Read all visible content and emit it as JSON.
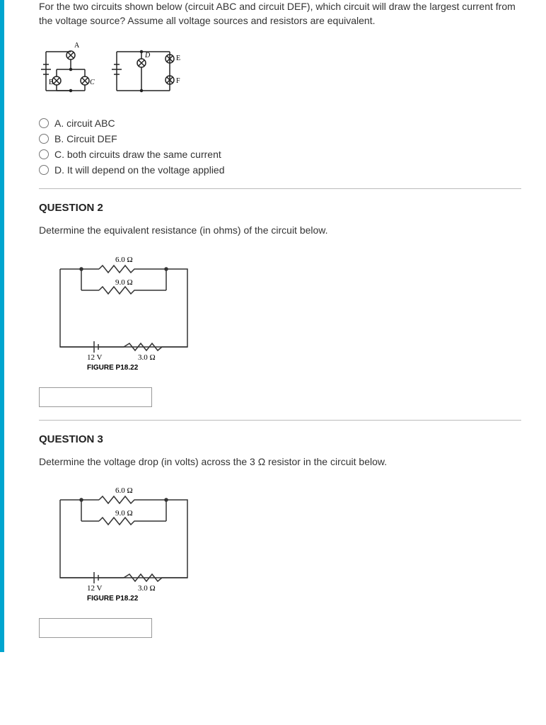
{
  "q1": {
    "prompt": "For the two circuits shown below (circuit ABC and circuit DEF), which circuit will draw the largest current from the voltage source? Assume all voltage sources and resistors are equivalent.",
    "labels": {
      "A": "A",
      "B": "B",
      "C": "C",
      "D": "D",
      "E": "E",
      "F": "F"
    },
    "options": {
      "a": "A. circuit ABC",
      "b": "B. Circuit DEF",
      "c": "C. both circuits draw the same current",
      "d": "D. It will depend on the voltage applied"
    }
  },
  "q2": {
    "heading": "QUESTION 2",
    "prompt": "Determine the equivalent resistance (in ohms) of the circuit below.",
    "fig": {
      "r1": "6.0 Ω",
      "r2": "9.0 Ω",
      "r3": "3.0 Ω",
      "v": "12 V",
      "caption": "FIGURE P18.22"
    },
    "answer": ""
  },
  "q3": {
    "heading": "QUESTION 3",
    "prompt": "Determine the voltage drop (in volts) across the 3 Ω resistor in the circuit below.",
    "fig": {
      "r1": "6.0 Ω",
      "r2": "9.0 Ω",
      "r3": "3.0 Ω",
      "v": "12 V",
      "caption": "FIGURE P18.22"
    },
    "answer": ""
  }
}
